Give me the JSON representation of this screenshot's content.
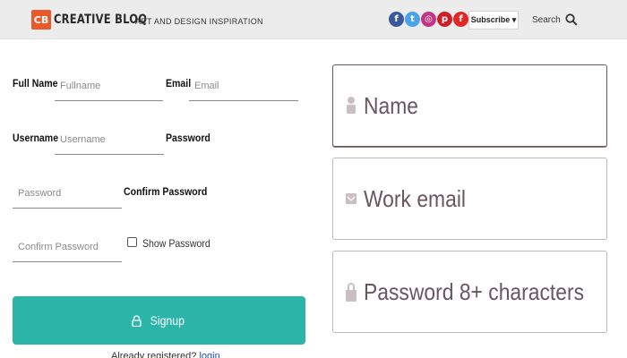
{
  "header": {
    "logo_badge": "CB",
    "logo_text": "CREATIVE BLOQ",
    "tagline": "ART AND DESIGN INSPIRATION",
    "social": [
      {
        "name": "facebook-icon",
        "glyph": "f",
        "color": "#3b5998"
      },
      {
        "name": "twitter-icon",
        "glyph": "t",
        "color": "#4aa3e8"
      },
      {
        "name": "instagram-icon",
        "glyph": "◎",
        "color": "#c13584"
      },
      {
        "name": "pinterest-icon",
        "glyph": "p",
        "color": "#cb2027"
      },
      {
        "name": "flipboard-icon",
        "glyph": "f",
        "color": "#e12828"
      }
    ],
    "subscribe_label": "Subscribe ▾",
    "search_label": "Search"
  },
  "form": {
    "fullname_label": "Full Name",
    "fullname_placeholder": "Fullname",
    "email_label": "Email",
    "email_placeholder": "Email",
    "username_label": "Username",
    "username_placeholder": "Username",
    "password_label": "Password",
    "password_placeholder": "Password",
    "confirm_label": "Confirm Password",
    "confirm_placeholder": "Confirm Password",
    "show_password_label": "Show Password",
    "signup_label": "Signup",
    "already_text": "Already registered?",
    "login_link": "login"
  },
  "right": {
    "name_placeholder": "Name",
    "email_placeholder": "Work email",
    "password_placeholder": "Password 8+ characters"
  },
  "colors": {
    "accent": "#2bb5a8",
    "brand": "#e85a2c",
    "link": "#1f4fd1"
  }
}
